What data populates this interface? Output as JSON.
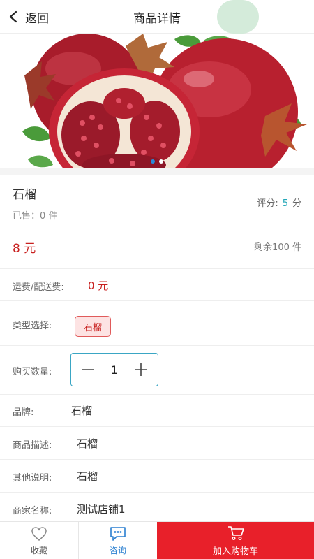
{
  "header": {
    "back_label": "返回",
    "title": "商品详情"
  },
  "product": {
    "name": "石榴",
    "sold": "已售：0 件",
    "rating_label": "评分:",
    "rating_value": "5",
    "rating_unit": "分",
    "price": "8 元",
    "stock": "剩余100 件"
  },
  "shipping": {
    "label": "运费/配送费:",
    "value": "0 元"
  },
  "type_select": {
    "label": "类型选择:",
    "option": "石榴"
  },
  "quantity": {
    "label": "购买数量:",
    "value": "1",
    "minus": "—",
    "plus": "+"
  },
  "details": [
    {
      "label": "品牌:",
      "value": "石榴"
    },
    {
      "label": "商品描述:",
      "value": "石榴"
    },
    {
      "label": "其他说明:",
      "value": "石榴"
    },
    {
      "label": "商家名称:",
      "value": "测试店铺1"
    }
  ],
  "bottom_bar": {
    "favorite": "收藏",
    "consult": "咨询",
    "add_to_cart": "加入购物车"
  },
  "colors": {
    "accent_red": "#e8202a",
    "price_red": "#c8201f",
    "teal": "#23a7b8",
    "blue": "#2a7fd0"
  },
  "icons": [
    "chevron-left-icon",
    "heart-icon",
    "chat-icon",
    "cart-icon"
  ]
}
